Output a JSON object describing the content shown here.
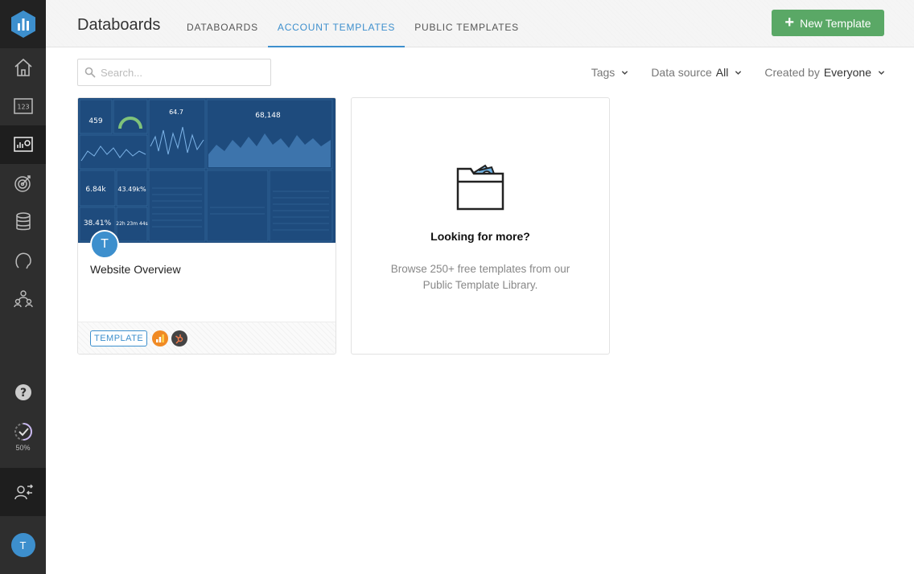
{
  "sidebar": {
    "progress_label": "50%",
    "avatar_initial": "T",
    "accent": "#3d8fcd"
  },
  "header": {
    "title": "Databoards",
    "tabs": [
      {
        "label": "DATABOARDS",
        "active": false
      },
      {
        "label": "ACCOUNT TEMPLATES",
        "active": true
      },
      {
        "label": "PUBLIC TEMPLATES",
        "active": false
      }
    ],
    "new_button": "New Template",
    "new_button_color": "#5aa866"
  },
  "toolbar": {
    "search_placeholder": "Search...",
    "filters": {
      "tags_label": "Tags",
      "source_label": "Data source",
      "source_value": "All",
      "created_label": "Created by",
      "created_value": "Everyone"
    }
  },
  "cards": {
    "template": {
      "name": "Website Overview",
      "avatar_initial": "T",
      "badge": "TEMPLATE",
      "sources": [
        "google-analytics-icon",
        "hubspot-icon"
      ],
      "thumb_metrics": [
        "459",
        "64.7",
        "68,148",
        "6.84k",
        "43.49k%",
        "38.41%",
        "22h 23m 44s"
      ]
    },
    "more": {
      "title": "Looking for more?",
      "description": "Browse 250+ free templates from our Public Template Library."
    }
  }
}
